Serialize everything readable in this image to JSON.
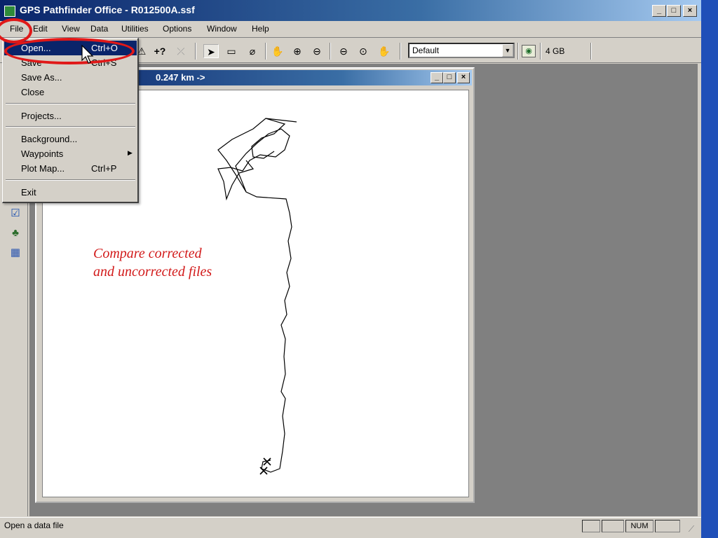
{
  "window": {
    "title": "GPS Pathfinder Office - R012500A.ssf",
    "app_icon": "pathfinder-app-icon",
    "buttons": {
      "minimize": "_",
      "maximize": "□",
      "close": "×"
    }
  },
  "menubar": [
    "File",
    "Edit",
    "View",
    "Data",
    "Utilities",
    "Options",
    "Window",
    "Help"
  ],
  "toolbar": {
    "items_before_combo": [
      {
        "icon": "waypoint-icon",
        "glyph": "⚠"
      },
      {
        "icon": "add-query-icon",
        "glyph": "+?"
      },
      {
        "icon": "distance-icon",
        "glyph": "⤫"
      },
      {
        "icon": "select-pointer-icon",
        "glyph": "➤"
      },
      {
        "icon": "measure-ruler-icon",
        "glyph": "▭"
      },
      {
        "icon": "eraser-icon",
        "glyph": "⌀"
      },
      {
        "icon": "pan-hand-icon",
        "glyph": "✋"
      },
      {
        "icon": "zoom-in-icon",
        "glyph": "⊕"
      },
      {
        "icon": "zoom-out-icon",
        "glyph": "⊖"
      },
      {
        "icon": "zoom-extents-icon",
        "glyph": "⊖"
      },
      {
        "icon": "zoom-previous-icon",
        "glyph": "⊙"
      },
      {
        "icon": "pan-to-icon",
        "glyph": "✋"
      }
    ],
    "layer_combo_value": "Default",
    "storage_icon": "globe-storage-icon",
    "storage_label": "4 GB"
  },
  "file_menu": {
    "items": [
      {
        "label": "Open...",
        "shortcut": "Ctrl+O",
        "selected": true
      },
      {
        "label": "Save",
        "shortcut": "Ctrl+S"
      },
      {
        "label": "Save As...",
        "shortcut": ""
      },
      {
        "label": "Close",
        "shortcut": ""
      },
      {
        "label": "Projects...",
        "shortcut": ""
      },
      {
        "label": "Background...",
        "shortcut": ""
      },
      {
        "label": "Waypoints",
        "shortcut": "",
        "submenu": true
      },
      {
        "label": "Plot Map...",
        "shortcut": "Ctrl+P"
      },
      {
        "label": "Exit",
        "shortcut": ""
      }
    ]
  },
  "map_window": {
    "title": "0.247 km ->",
    "buttons": {
      "minimize": "_",
      "maximize": "□",
      "close": "×"
    }
  },
  "annotation": {
    "line1": "Compare corrected",
    "line2": "and uncorrected files",
    "color": "#d21a1a"
  },
  "statusbar": {
    "text": "Open a data file",
    "num": "NUM"
  },
  "colors": {
    "accent_red": "#e01818",
    "titlebar": "#0a246a",
    "desktop": "#1f4fb8",
    "mdi_background": "#808080"
  }
}
